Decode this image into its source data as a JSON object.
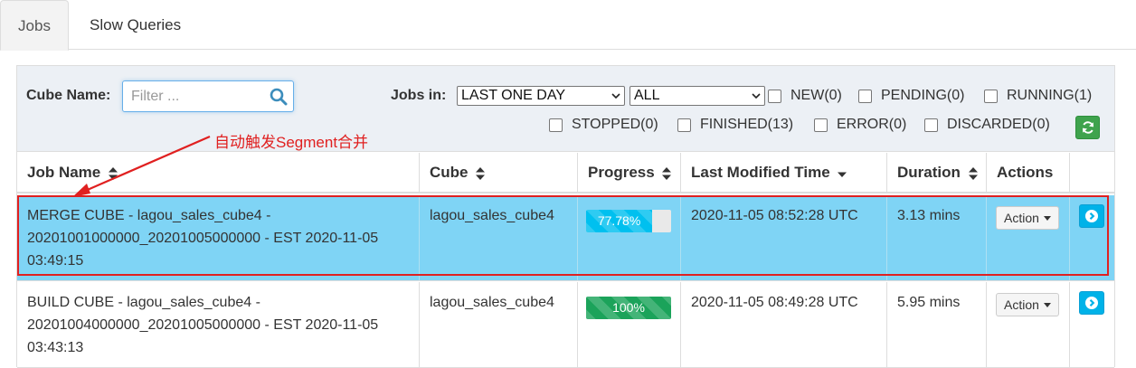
{
  "tabs": [
    {
      "label": "Jobs",
      "active": true
    },
    {
      "label": "Slow Queries",
      "active": false
    }
  ],
  "filters": {
    "cube_name_label": "Cube Name:",
    "search_placeholder": "Filter ...",
    "jobs_in_label": "Jobs in:",
    "time_range": "LAST ONE DAY",
    "project": "ALL",
    "statuses": [
      {
        "label": "NEW(0)",
        "checked": false
      },
      {
        "label": "PENDING(0)",
        "checked": false
      },
      {
        "label": "RUNNING(1)",
        "checked": false
      },
      {
        "label": "STOPPED(0)",
        "checked": false
      },
      {
        "label": "FINISHED(13)",
        "checked": false
      },
      {
        "label": "ERROR(0)",
        "checked": false
      },
      {
        "label": "DISCARDED(0)",
        "checked": false
      }
    ],
    "refresh_icon": "refresh-icon"
  },
  "table": {
    "columns": [
      "Job Name",
      "Cube",
      "Progress",
      "Last Modified Time",
      "Duration",
      "Actions"
    ],
    "rows": [
      {
        "job_name": "MERGE CUBE - lagou_sales_cube4 - 20201001000000_20201005000000 - EST 2020-11-05 03:49:15",
        "cube": "lagou_sales_cube4",
        "progress_label": "77.78%",
        "progress": 77.78,
        "progress_color": "#00c0ef",
        "last_modified": "2020-11-05 08:52:28 UTC",
        "duration": "3.13 mins",
        "action_label": "Action",
        "highlighted": true
      },
      {
        "job_name": "BUILD CUBE - lagou_sales_cube4 - 20201004000000_20201005000000 - EST 2020-11-05 03:43:13",
        "cube": "lagou_sales_cube4",
        "progress_label": "100%",
        "progress": 100,
        "progress_color": "#1ba35a",
        "last_modified": "2020-11-05 08:49:28 UTC",
        "duration": "5.95 mins",
        "action_label": "Action",
        "highlighted": false
      }
    ]
  },
  "annotation": {
    "text": "自动触发Segment合并",
    "color": "#e02020"
  },
  "colors": {
    "highlight_row": "#7fd4f5",
    "filter_bar": "#ecf0f5",
    "refresh_button": "#3fa34d",
    "detail_button": "#00b2e8"
  }
}
